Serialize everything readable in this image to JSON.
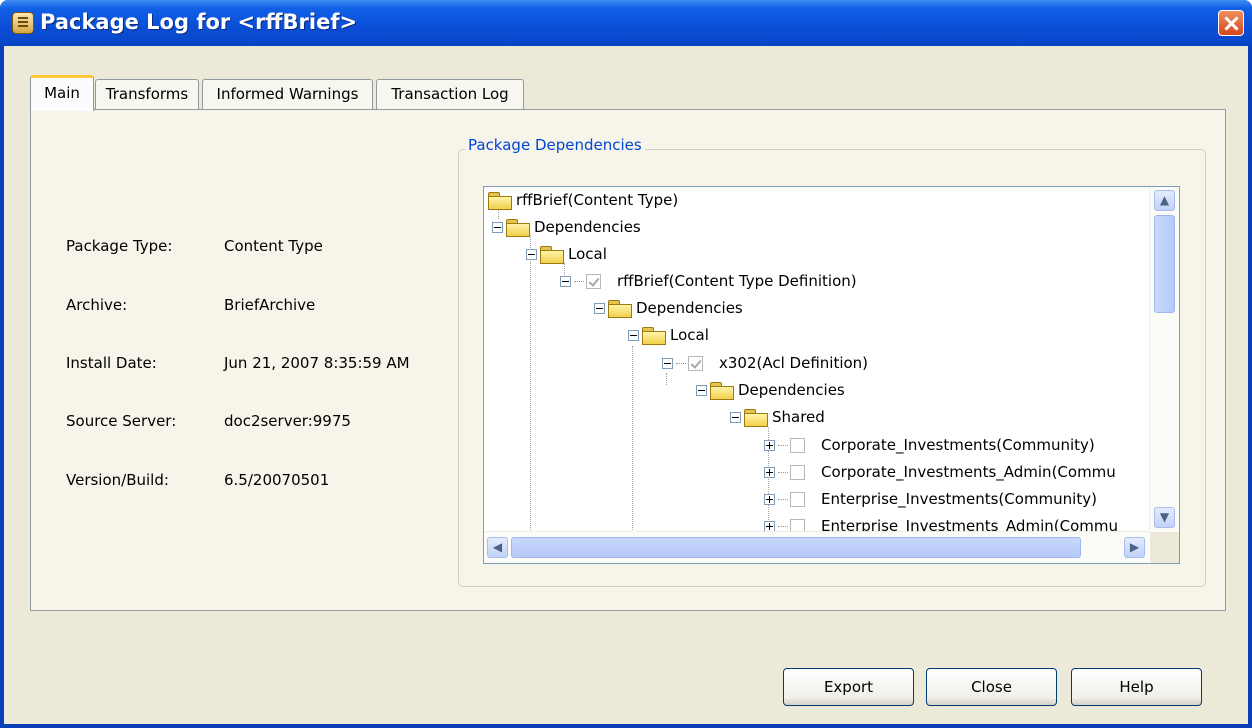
{
  "window": {
    "title": "Package Log for <rffBrief>"
  },
  "tabs": [
    {
      "label": "Main",
      "active": true
    },
    {
      "label": "Transforms",
      "active": false
    },
    {
      "label": "Informed Warnings",
      "active": false
    },
    {
      "label": "Transaction Log",
      "active": false
    }
  ],
  "info": {
    "package_type_label": "Package Type:",
    "package_type_value": "Content Type",
    "archive_label": "Archive:",
    "archive_value": "BriefArchive",
    "install_date_label": "Install Date:",
    "install_date_value": "Jun 21, 2007 8:35:59 AM",
    "source_server_label": "Source Server:",
    "source_server_value": "doc2server:9975",
    "version_label": "Version/Build:",
    "version_value": "6.5/20070501"
  },
  "dependencies": {
    "group_title": "Package Dependencies",
    "nodes": [
      {
        "label": "rffBrief(Content Type)",
        "icon": "folder-icon"
      },
      {
        "label": "Dependencies",
        "icon": "folder-icon",
        "expander": "minus"
      },
      {
        "label": "Local",
        "icon": "folder-icon",
        "expander": "minus"
      },
      {
        "label": "rffBrief(Content Type Definition)",
        "icon": "checkbox",
        "checked": true,
        "expander": "minus"
      },
      {
        "label": "Dependencies",
        "icon": "folder-icon",
        "expander": "minus"
      },
      {
        "label": "Local",
        "icon": "folder-icon",
        "expander": "minus"
      },
      {
        "label": "x302(Acl Definition)",
        "icon": "checkbox",
        "checked": true,
        "expander": "minus"
      },
      {
        "label": "Dependencies",
        "icon": "folder-icon",
        "expander": "minus"
      },
      {
        "label": "Shared",
        "icon": "folder-icon",
        "expander": "minus"
      },
      {
        "label": "Corporate_Investments(Community)",
        "icon": "checkbox",
        "checked": false,
        "expander": "plus"
      },
      {
        "label": "Corporate_Investments_Admin(Commu",
        "icon": "checkbox",
        "checked": false,
        "expander": "plus"
      },
      {
        "label": "Enterprise_Investments(Community)",
        "icon": "checkbox",
        "checked": false,
        "expander": "plus"
      },
      {
        "label": "Enterprise_Investments_Admin(Commu",
        "icon": "checkbox",
        "checked": false,
        "expander": "plus"
      }
    ]
  },
  "buttons": {
    "export": "Export",
    "close": "Close",
    "help": "Help"
  }
}
